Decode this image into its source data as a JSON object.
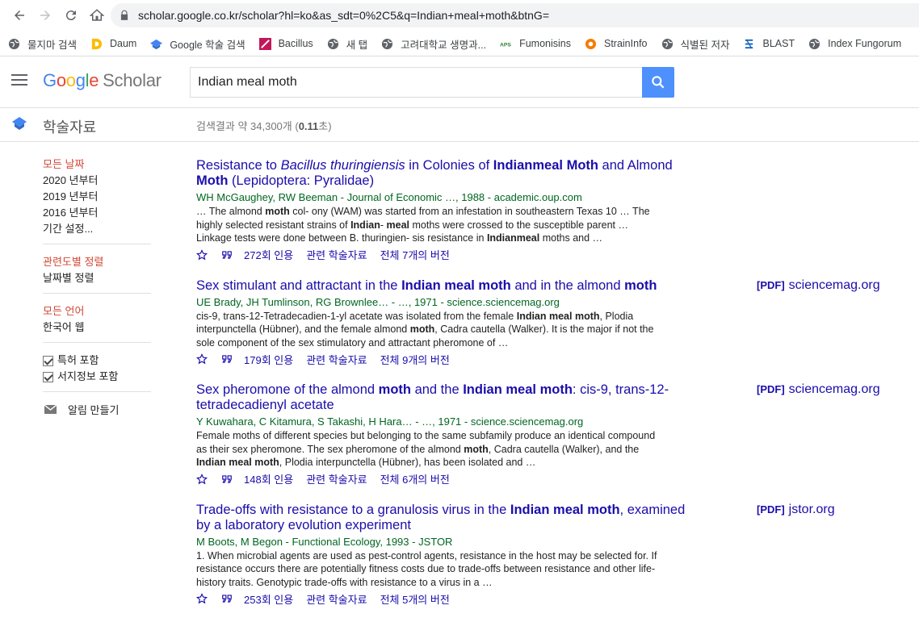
{
  "browser": {
    "url": "scholar.google.co.kr/scholar?hl=ko&as_sdt=0%2C5&q=Indian+meal+moth&btnG=",
    "bookmarks": [
      {
        "label": "물지마 검색",
        "icon": "globe-icon"
      },
      {
        "label": "Daum",
        "icon": "daum-icon"
      },
      {
        "label": "Google 학술 검색",
        "icon": "scholar-icon"
      },
      {
        "label": "Bacillus",
        "icon": "bacillus-icon"
      },
      {
        "label": "새 탭",
        "icon": "globe-icon"
      },
      {
        "label": "고려대학교 생명과...",
        "icon": "globe-icon"
      },
      {
        "label": "Fumonisins",
        "icon": "aps-icon"
      },
      {
        "label": "StrainInfo",
        "icon": "straininfo-icon"
      },
      {
        "label": "식별된 저자",
        "icon": "globe-icon"
      },
      {
        "label": "BLAST",
        "icon": "blast-icon"
      },
      {
        "label": "Index Fungorum",
        "icon": "globe-icon"
      }
    ]
  },
  "header": {
    "logo_scholar": "Scholar",
    "search_value": "Indian meal moth"
  },
  "subheader": {
    "section": "학술자료",
    "count_prefix": "검색결과 약 34,300개 (",
    "count_time": "0.11",
    "count_suffix": "초)"
  },
  "sidebar": {
    "dates": [
      "모든 날짜",
      "2020 년부터",
      "2019 년부터",
      "2016 년부터",
      "기간 설정..."
    ],
    "sort": [
      "관련도별 정렬",
      "날짜별 정렬"
    ],
    "lang": [
      "모든 언어",
      "한국어 웹"
    ],
    "checks": [
      "특허 포함",
      "서지정보 포함"
    ],
    "alert": "알림 만들기"
  },
  "results": [
    {
      "title_parts": [
        [
          "Resistance to ",
          ""
        ],
        [
          "Bacillus thuringiensis",
          "i"
        ],
        [
          " in Colonies of ",
          ""
        ],
        [
          "Indianmeal Moth",
          "b"
        ],
        [
          " and Almond ",
          ""
        ],
        [
          "Moth",
          "b"
        ],
        [
          " (Lepidoptera: Pyralidae)",
          ""
        ]
      ],
      "authors": "WH McGaughey, RW Beeman - Journal of Economic …, 1988 - academic.oup.com",
      "snippet_html": "… The almond <b>moth</b> col- ony (WAM) was started from an infestation in southeastern Texas 10 … The highly selected resistant strains of <b>Indian</b>- <b>meal</b> moths were crossed to the susceptible parent … Linkage tests were done between B. thuringien- sis resistance in <b>Indianmeal</b> moths and …",
      "cited": "272회 인용",
      "related": "관련 학술자료",
      "versions": "전체 7개의 버전",
      "pdf_tag": "",
      "pdf_source": ""
    },
    {
      "title_parts": [
        [
          "Sex stimulant and attractant in the ",
          ""
        ],
        [
          "Indian meal moth",
          "b"
        ],
        [
          " and in the almond ",
          ""
        ],
        [
          "moth",
          "b"
        ]
      ],
      "authors": "UE Brady, JH Tumlinson, RG Brownlee… - …, 1971 - science.sciencemag.org",
      "snippet_html": "cis-9, trans-12-Tetradecadien-1-yl acetate was isolated from the female <b>Indian meal moth</b>, Plodia interpunctella (Hübner), and the female almond <b>moth</b>, Cadra cautella (Walker). It is the major if not the sole component of the sex stimulatory and attractant pheromone of …",
      "cited": "179회 인용",
      "related": "관련 학술자료",
      "versions": "전체 9개의 버전",
      "pdf_tag": "[PDF]",
      "pdf_source": "sciencemag.org"
    },
    {
      "title_parts": [
        [
          "Sex pheromone of the almond ",
          ""
        ],
        [
          "moth",
          "b"
        ],
        [
          " and the ",
          ""
        ],
        [
          "Indian meal moth",
          "b"
        ],
        [
          ": cis-9, trans-12-tetradecadienyl acetate",
          ""
        ]
      ],
      "authors": "Y Kuwahara, C Kitamura, S Takashi, H Hara… - …, 1971 - science.sciencemag.org",
      "snippet_html": "Female moths of different species but belonging to the same subfamily produce an identical compound as their sex pheromone. The sex pheromone of the almond <b>moth</b>, Cadra cautella (Walker), and the <b>Indian meal moth</b>, Plodia interpunctella (Hübner), has been isolated and …",
      "cited": "148회 인용",
      "related": "관련 학술자료",
      "versions": "전체 6개의 버전",
      "pdf_tag": "[PDF]",
      "pdf_source": "sciencemag.org"
    },
    {
      "title_parts": [
        [
          "Trade-offs with resistance to a granulosis virus in the ",
          ""
        ],
        [
          "Indian meal moth",
          "b"
        ],
        [
          ", examined by a laboratory evolution experiment",
          ""
        ]
      ],
      "authors": "M Boots, M Begon - Functional Ecology, 1993 - JSTOR",
      "snippet_html": "1. When microbial agents are used as pest-control agents, resistance in the host may be selected for. If resistance occurs there are potentially fitness costs due to trade-offs between resistance and other life-history traits. Genotypic trade-offs with resistance to a virus in a …",
      "cited": "253회 인용",
      "related": "관련 학술자료",
      "versions": "전체 5개의 버전",
      "pdf_tag": "[PDF]",
      "pdf_source": "jstor.org"
    }
  ]
}
